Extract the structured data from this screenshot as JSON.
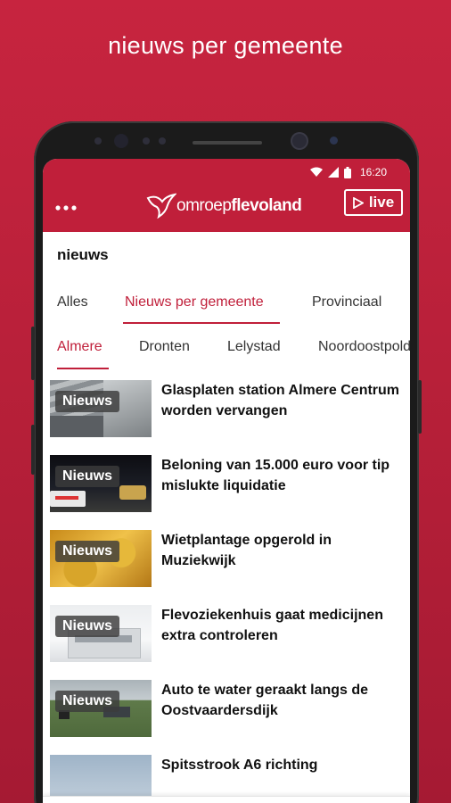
{
  "promo": {
    "title": "nieuws per gemeente"
  },
  "status_bar": {
    "time": "16:20"
  },
  "app_bar": {
    "logo": {
      "light": "omroep",
      "bold": "flevoland"
    },
    "live_label": "live"
  },
  "section_title": "nieuws",
  "category_tabs": [
    {
      "label": "Alles",
      "active": false
    },
    {
      "label": "Nieuws per gemeente",
      "active": true
    },
    {
      "label": "Provinciaal",
      "active": false
    }
  ],
  "municipality_tabs": [
    {
      "label": "Almere",
      "active": true
    },
    {
      "label": "Dronten",
      "active": false
    },
    {
      "label": "Lelystad",
      "active": false
    },
    {
      "label": "Noordoostpolder",
      "active": false
    }
  ],
  "news": [
    {
      "badge": "Nieuws",
      "headline": "Glasplaten station Almere Centrum worden vervangen"
    },
    {
      "badge": "Nieuws",
      "headline": "Beloning van 15.000 euro voor tip mislukte liquidatie"
    },
    {
      "badge": "Nieuws",
      "headline": "Wietplantage opgerold in Muziekwijk"
    },
    {
      "badge": "Nieuws",
      "headline": "Flevoziekenhuis gaat medicijnen extra controleren"
    },
    {
      "badge": "Nieuws",
      "headline": "Auto te water geraakt langs de Oostvaardersdijk"
    },
    {
      "badge": "",
      "headline": "Spitsstrook A6 richting"
    }
  ],
  "bottom_nav": [
    {
      "icon": "news-document-icon"
    },
    {
      "icon": "sports-ball-icon"
    },
    {
      "icon": "play-media-icon"
    },
    {
      "icon": "weather-sun-icon"
    },
    {
      "icon": "traffic-car-icon"
    }
  ],
  "colors": {
    "brand": "#c01f3a",
    "background": "#b51f38"
  }
}
